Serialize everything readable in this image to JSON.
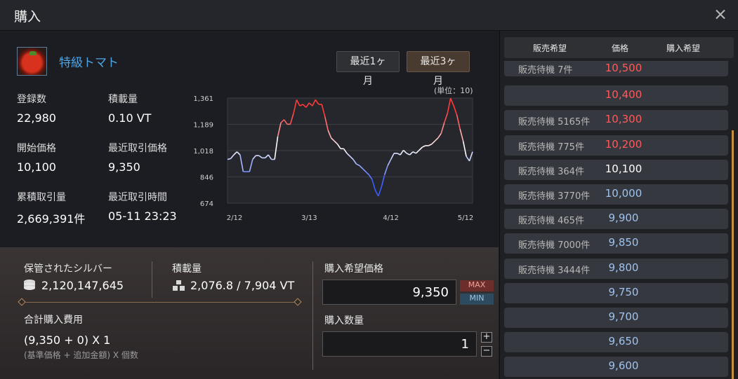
{
  "window": {
    "title": "購入"
  },
  "item": {
    "name": "特級トマト",
    "icon": "tomato-icon"
  },
  "range_buttons": [
    "最近1ヶ月",
    "最近3ヶ月"
  ],
  "stats": {
    "registered_label": "登録数",
    "registered_value": "22,980",
    "weight_label": "積載量",
    "weight_value": "0.10 VT",
    "start_price_label": "開始価格",
    "start_price_value": "10,100",
    "recent_price_label": "最近取引価格",
    "recent_price_value": "9,350",
    "total_volume_label": "累積取引量",
    "total_volume_value": "2,669,391件",
    "recent_time_label": "最近取引時間",
    "recent_time_value": "05-11 23:23"
  },
  "chart_unit": "(単位：10)",
  "chart_data": {
    "type": "line",
    "title": "",
    "xlabel": "",
    "ylabel": "",
    "x_ticks": [
      "2/12",
      "3/13",
      "4/12",
      "5/12"
    ],
    "y_ticks": [
      "1,361",
      "1,189",
      "1,018",
      "846",
      "674"
    ],
    "ylim": [
      674,
      1361
    ],
    "grid": true,
    "series": [
      {
        "values": [
          960,
          965,
          990,
          1010,
          990,
          880,
          880,
          880,
          960,
          985,
          985,
          970,
          970,
          990,
          960,
          960,
          1110,
          1200,
          1220,
          1190,
          1190,
          1260,
          1350,
          1310,
          1320,
          1300,
          1330,
          1310,
          1350,
          1320,
          1320,
          1240,
          1150,
          1100,
          1080,
          1060,
          1030,
          1030,
          1000,
          980,
          960,
          930,
          920,
          900,
          880,
          860,
          830,
          760,
          720,
          780,
          860,
          920,
          960,
          1000,
          1000,
          990,
          1020,
          1000,
          990,
          1010,
          1000,
          1020,
          1040,
          1050,
          1050,
          1060,
          1080,
          1100,
          1130,
          1200,
          1260,
          1360,
          1310,
          1250,
          1160,
          1080,
          980,
          950,
          1010
        ]
      }
    ],
    "colors": {
      "high": "#ff3b3b",
      "mid": "#ffffff",
      "low": "#3b5cff"
    }
  },
  "purchase": {
    "silver_label": "保管されたシルバー",
    "silver_value": "2,120,147,645",
    "weight_label": "積載量",
    "weight_value": "2,076.8 / 7,904 VT",
    "total_cost_label": "合計購入費用",
    "total_cost_formula": "(9,350 + 0) X 1",
    "total_cost_note": "(基準価格 + 追加金額) X 個数",
    "buy_price_label": "購入希望価格",
    "buy_price_value": "9,350",
    "max_label": "MAX",
    "min_label": "MIN",
    "quantity_label": "購入数量",
    "quantity_value": "1",
    "plus": "+",
    "minus": "−"
  },
  "orderbook": {
    "headers": [
      "販売希望",
      "価格",
      "購入希望"
    ],
    "rows": [
      {
        "sell": "販売待機 7件",
        "price": "10,500",
        "color": "#ff5a5a"
      },
      {
        "sell": "",
        "price": "10,400",
        "color": "#ff5a5a"
      },
      {
        "sell": "販売待機 5165件",
        "price": "10,300",
        "color": "#ff5a5a"
      },
      {
        "sell": "販売待機 775件",
        "price": "10,200",
        "color": "#ff5a5a"
      },
      {
        "sell": "販売待機 364件",
        "price": "10,100",
        "color": "#ffffff"
      },
      {
        "sell": "販売待機 3770件",
        "price": "10,000",
        "color": "#9fc3ee"
      },
      {
        "sell": "販売待機 465件",
        "price": "9,900",
        "color": "#9fc3ee"
      },
      {
        "sell": "販売待機 7000件",
        "price": "9,850",
        "color": "#9fc3ee"
      },
      {
        "sell": "販売待機 3444件",
        "price": "9,800",
        "color": "#9fc3ee"
      },
      {
        "sell": "",
        "price": "9,750",
        "color": "#9fc3ee"
      },
      {
        "sell": "",
        "price": "9,700",
        "color": "#9fc3ee"
      },
      {
        "sell": "",
        "price": "9,650",
        "color": "#9fc3ee"
      },
      {
        "sell": "",
        "price": "9,600",
        "color": "#9fc3ee"
      }
    ]
  }
}
